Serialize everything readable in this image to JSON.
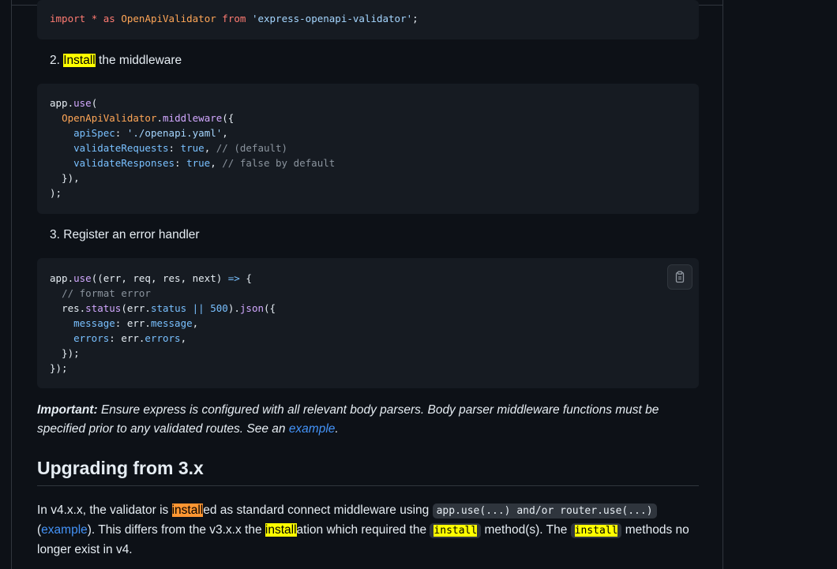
{
  "import_block": {
    "line": {
      "kw1": "import",
      "star": "*",
      "as": "as",
      "name": "OpenApiValidator",
      "from": "from",
      "module": "'express-openapi-validator'",
      "semi": ";"
    }
  },
  "step2": {
    "num": "2.",
    "hl": "Install",
    "rest": " the middleware"
  },
  "code2": {
    "l1_obj": "app",
    "l1_fn": "use",
    "l1_open": "(",
    "l2_cls": "OpenApiValidator",
    "l2_fn": "middleware",
    "l2_open": "({",
    "l3_prop": "apiSpec",
    "l3_str": "'./openapi.yaml'",
    "l4_prop": "validateRequests",
    "l4_val": "true",
    "l4_com": "// (default)",
    "l5_prop": "validateResponses",
    "l5_val": "true",
    "l5_com": "// false by default",
    "l6": "  }),",
    "l7": ");"
  },
  "step3": {
    "num": "3.",
    "text": "Register an error handler"
  },
  "code3": {
    "l1_a": "app.",
    "l1_fn": "use",
    "l1_b": "((err, req, res, next) ",
    "l1_arrow": "=>",
    "l1_c": " {",
    "l2_com": "// format error",
    "l3_a": "res.",
    "l3_fn": "status",
    "l3_b": "(err.",
    "l3_prop": "status",
    "l3_op": "||",
    "l3_num": "500",
    "l3_c": ").",
    "l3_fn2": "json",
    "l3_d": "({",
    "l4_prop": "message",
    "l4_b": ": err.",
    "l4_prop2": "message",
    "l4_c": ",",
    "l5_prop": "errors",
    "l5_b": ": err.",
    "l5_prop2": "errors",
    "l5_c": ",",
    "l6": "  });",
    "l7": "});",
    "copy_icon": "clipboard-icon"
  },
  "important": {
    "label": "Important:",
    "text": " Ensure express is configured with all relevant body parsers. Body parser middleware functions must be specified prior to any validated routes. See an ",
    "link": "example",
    "end": "."
  },
  "heading": "Upgrading from 3.x",
  "upgrade": {
    "t1": "In v4.x.x, the validator is ",
    "hl1": "install",
    "t2": "ed as standard connect middleware using ",
    "code1": "app.use(...) and/or router.use(...)",
    "t3": " (",
    "link": "example",
    "t4": "). This differs from the v3.x.x the ",
    "hl2": "install",
    "t5": "ation which required the ",
    "code2": "install",
    "t6": " method(s). The ",
    "code3": "install",
    "t7": " methods no longer exist in v4."
  },
  "colors": {
    "background": "#0d1117",
    "code_bg": "#161b22",
    "highlight": "#ffff00",
    "highlight_current": "#ff9632",
    "link": "#4493f8"
  }
}
